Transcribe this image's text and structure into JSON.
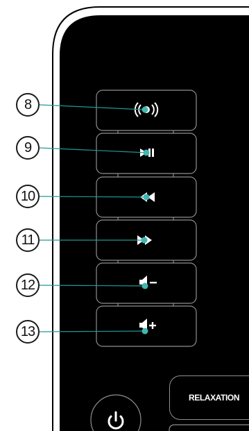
{
  "callouts": [
    {
      "number": "8",
      "target": "bluetooth-button"
    },
    {
      "number": "9",
      "target": "play-pause-button"
    },
    {
      "number": "10",
      "target": "previous-button"
    },
    {
      "number": "11",
      "target": "next-button"
    },
    {
      "number": "12",
      "target": "volume-down-button"
    },
    {
      "number": "13",
      "target": "volume-up-button"
    }
  ],
  "buttons": {
    "relaxation_label": "RELAXATION"
  },
  "colors": {
    "device_body": "#000000",
    "button_border": "#8f8f8f",
    "leader_line": "#1e9a94",
    "leader_dot": "#3fb8b0",
    "icon": "#ffffff"
  },
  "icons": [
    "bluetooth-icon",
    "play-pause-icon",
    "previous-icon",
    "next-icon",
    "volume-down-icon",
    "volume-up-icon",
    "power-icon"
  ]
}
